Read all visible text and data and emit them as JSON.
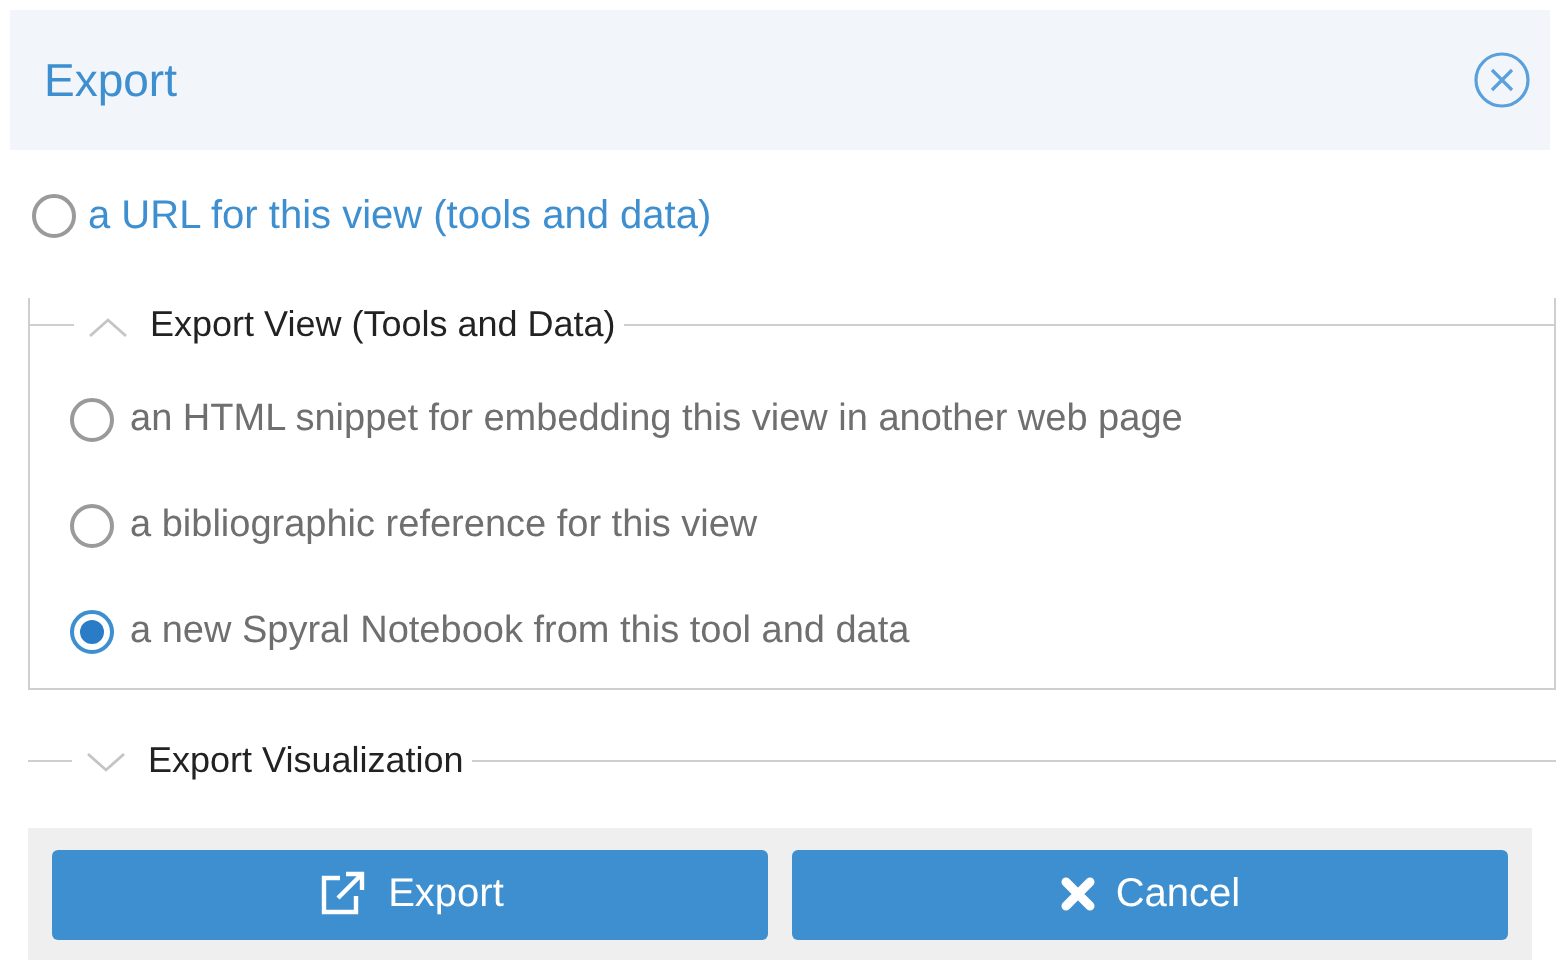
{
  "dialog": {
    "title": "Export"
  },
  "url_option": {
    "label": "a URL for this view (tools and data)",
    "selected": false
  },
  "sections": [
    {
      "title": "Export View (Tools and Data)",
      "expanded": true,
      "options": [
        {
          "label": "an HTML snippet for embedding this view in another web page",
          "selected": false
        },
        {
          "label": "a bibliographic reference for this view",
          "selected": false
        },
        {
          "label": "a new Spyral Notebook from this tool and data",
          "selected": true
        }
      ]
    },
    {
      "title": "Export Visualization",
      "expanded": false
    }
  ],
  "buttons": [
    {
      "kind": "export",
      "label": "Export"
    },
    {
      "kind": "cancel",
      "label": "Cancel"
    }
  ]
}
